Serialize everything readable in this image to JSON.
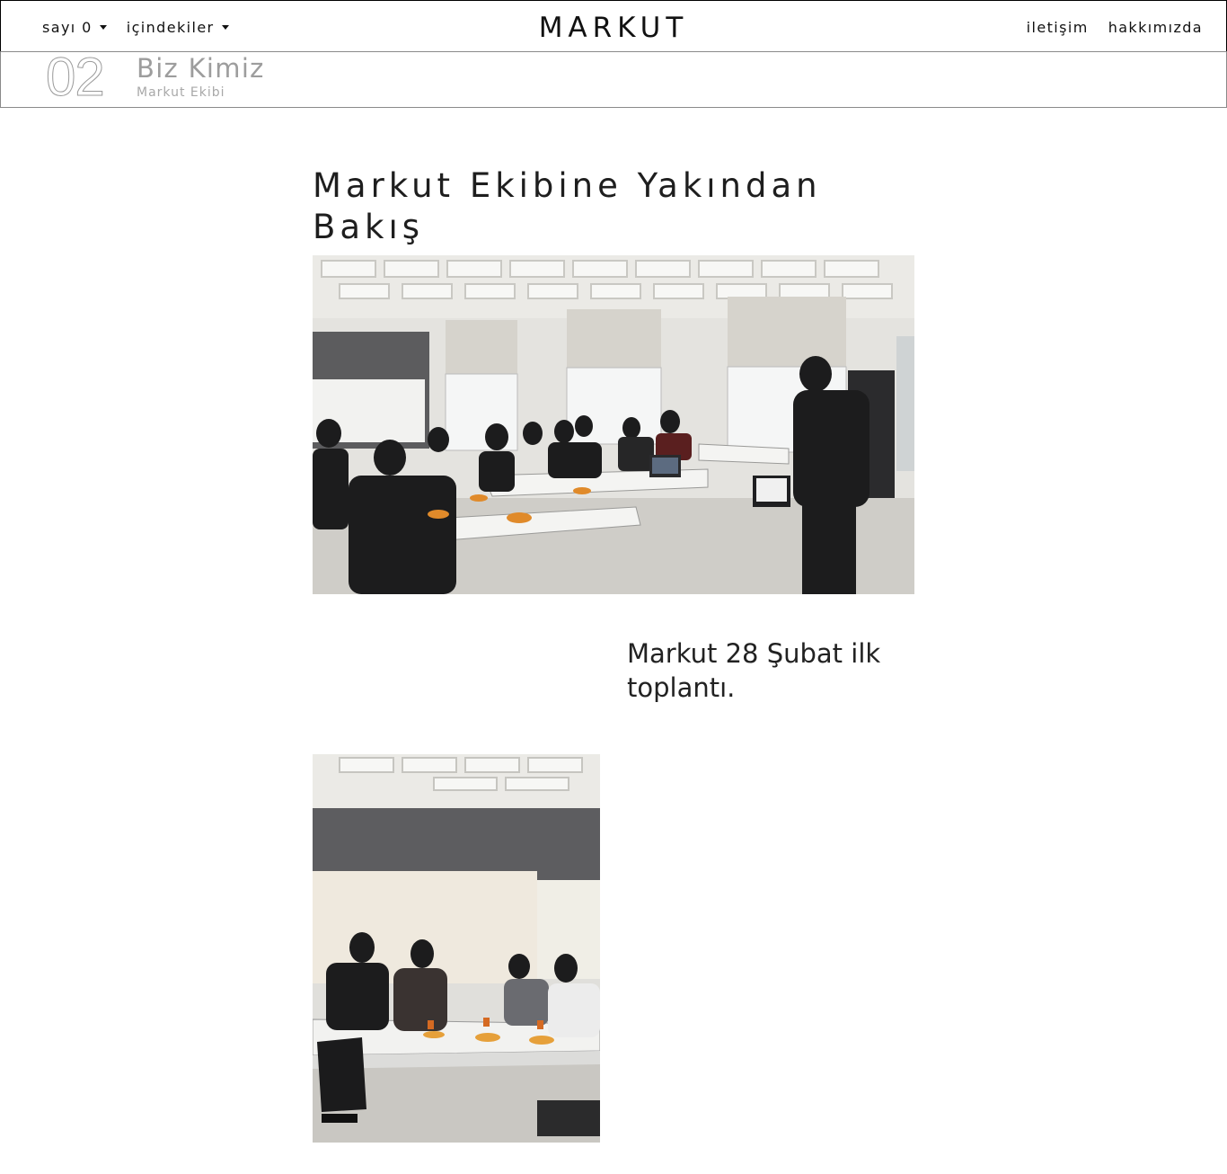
{
  "nav": {
    "issue_dropdown": "sayı 0",
    "contents_dropdown": "içindekiler",
    "brand": "MARKUT",
    "links": [
      "iletişim",
      "hakkımızda"
    ]
  },
  "issue": {
    "number": "02",
    "title": "Biz Kimiz",
    "subtitle": "Markut Ekibi"
  },
  "article": {
    "title": "Markut Ekibine Yakından Bakış",
    "caption": "Markut 28 Şubat ilk toplantı.",
    "photos": [
      {
        "name": "meeting-photo-wide",
        "alt": "classroom meeting photo"
      },
      {
        "name": "meeting-photo-tall",
        "alt": "team members at table photo"
      }
    ]
  }
}
